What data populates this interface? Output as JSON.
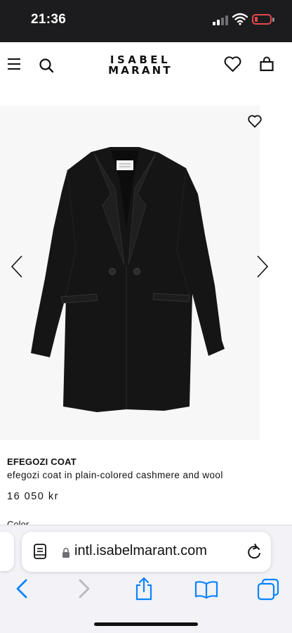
{
  "status_bar": {
    "time": "21:36"
  },
  "header": {
    "logo_line1": "ISABEL",
    "logo_line2": "MARANT",
    "icons": [
      "menu-icon",
      "search-icon",
      "heart-icon",
      "bag-icon"
    ]
  },
  "product": {
    "name": "EFEGOZI COAT",
    "description": "efegozi coat in plain-colored cashmere and wool",
    "price": "16 050 kr",
    "color_label": "Color"
  },
  "browser": {
    "url": "intl.isabelmarant.com",
    "icons": [
      "reader-icon",
      "lock-icon",
      "reload-icon",
      "back-icon",
      "forward-icon",
      "share-icon",
      "bookmarks-icon",
      "tabs-icon"
    ]
  },
  "colors": {
    "status_bar_bg": "#1c1c1e",
    "coat": "#151515",
    "link_blue": "#0a84ff",
    "battery_low": "#e5484d"
  }
}
